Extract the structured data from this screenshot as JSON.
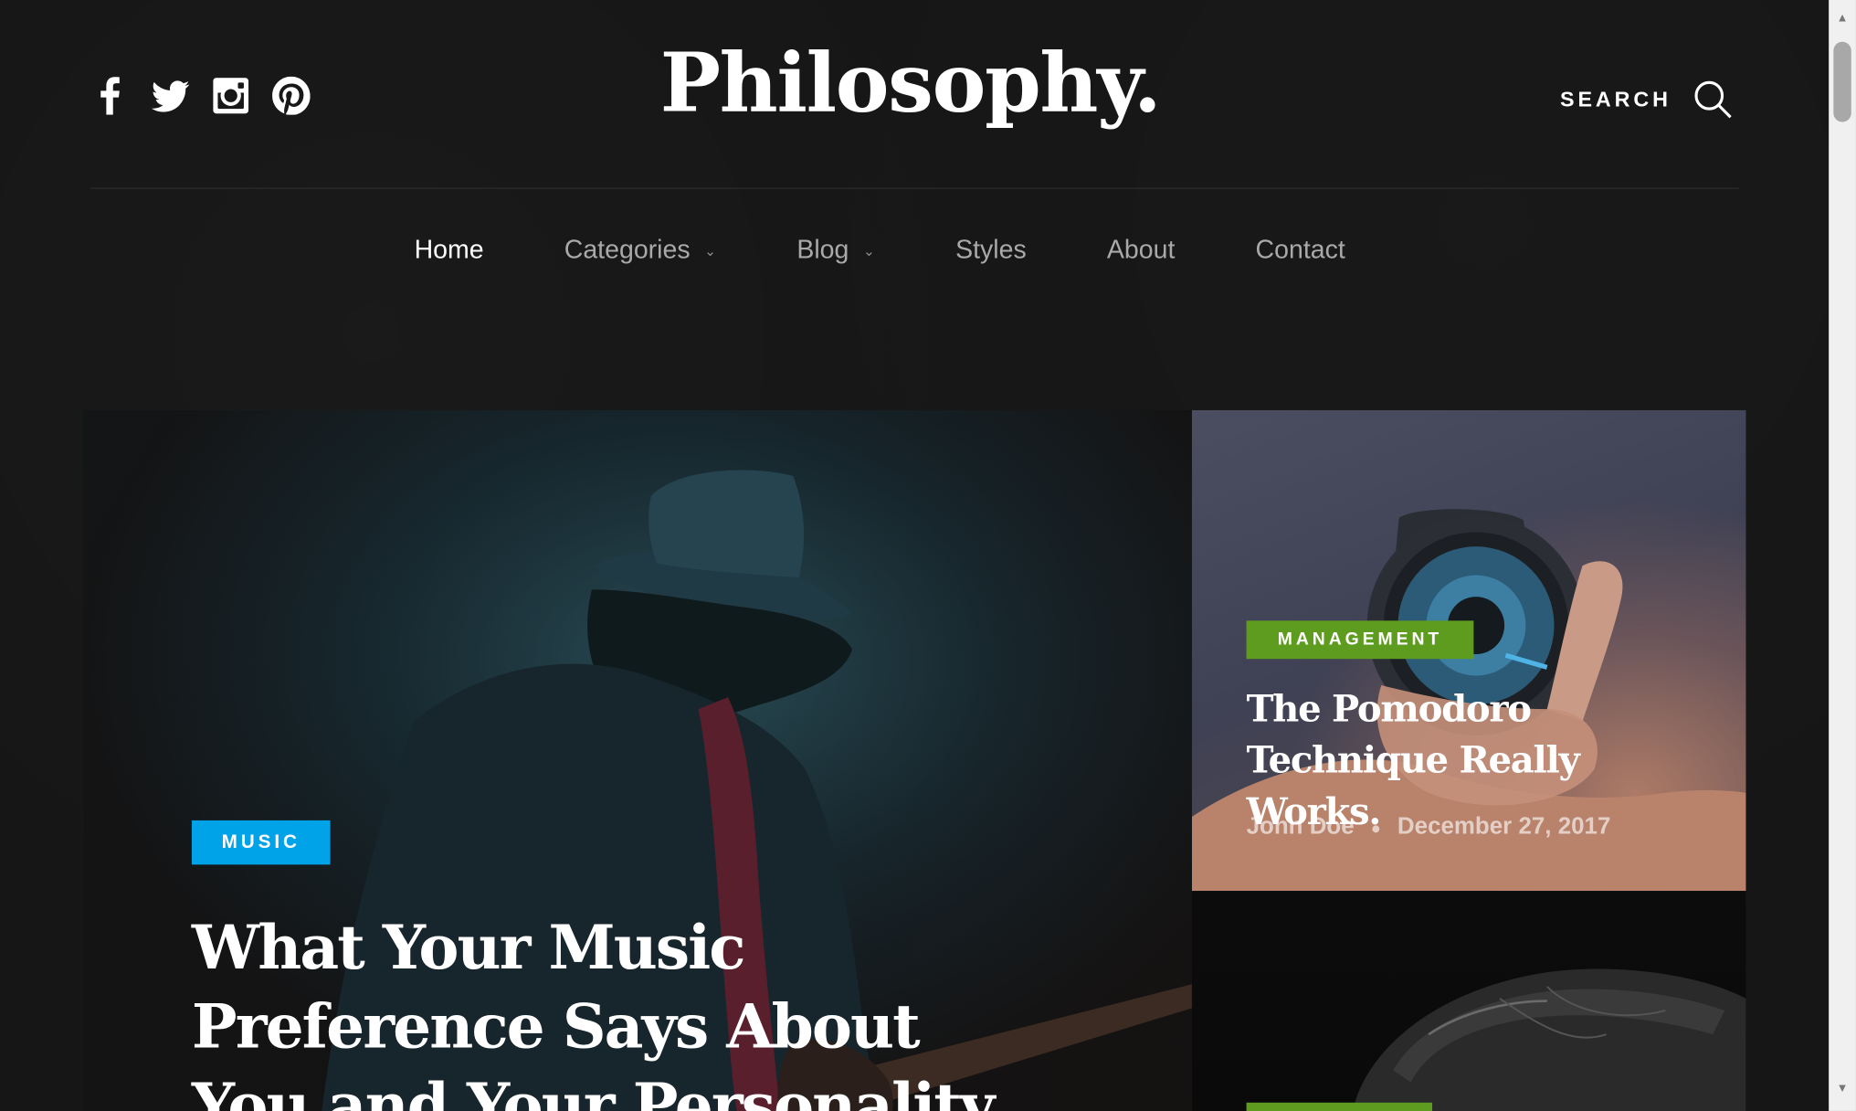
{
  "site": {
    "logo": "Philosophy.",
    "social_icons": [
      "facebook-icon",
      "twitter-icon",
      "instagram-icon",
      "pinterest-icon"
    ],
    "search_label": "SEARCH"
  },
  "nav": {
    "items": [
      {
        "label": "Home",
        "active": true
      },
      {
        "label": "Categories",
        "dropdown": true
      },
      {
        "label": "Blog",
        "dropdown": true
      },
      {
        "label": "Styles"
      },
      {
        "label": "About"
      },
      {
        "label": "Contact"
      }
    ]
  },
  "featured": {
    "main": {
      "category": "MUSIC",
      "category_color": "#00a2e8",
      "title": "What Your Music Preference Says About You and Your Personality."
    },
    "side": [
      {
        "category": "MANAGEMENT",
        "category_color": "#5e9c1f",
        "title": "The Pomodoro Technique Really Works.",
        "author": "John Doe",
        "date": "December 27, 2017"
      },
      {
        "category_color": "#5e9c1f"
      }
    ]
  },
  "colors": {
    "background": "#161616",
    "text": "#ffffff",
    "nav_inactive": "#a9a9a9"
  }
}
